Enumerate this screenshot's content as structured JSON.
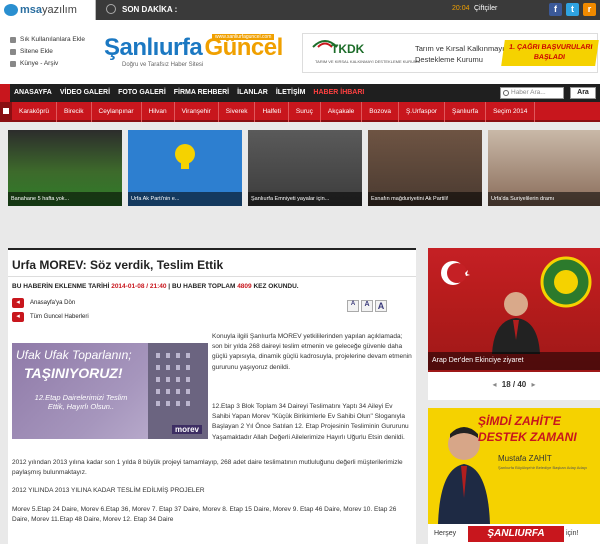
{
  "topbar": {
    "logo_prefix": "msa",
    "logo_suffix": "yazılım",
    "breaking_label": "SON DAKİKA :",
    "time": "20:04",
    "user_link": "Çiftçiler"
  },
  "header_links": [
    "Sık Kullanılanlara Ekle",
    "Sitene Ekle",
    "Künye - Arşiv"
  ],
  "brand": {
    "part1": "Şanlıurfa",
    "part2": "Güncel",
    "tagline": "Doğru ve Tarafsız Haber Sitesi",
    "url": "www.sanliurfaguncel.com"
  },
  "ad_top": {
    "org": "TKDK",
    "org_sub": "TARIM VE KIRSAL KALKINMAYI DESTEKLEME KURUMU",
    "line1": "Tarım ve Kırsal Kalkınmayı",
    "line2": "Destekleme Kurumu",
    "badge": "1. ÇAĞRI BAŞVURULARI BAŞLADI"
  },
  "nav": {
    "items": [
      "ANASAYFA",
      "VİDEO GALERİ",
      "FOTO GALERİ",
      "FİRMA REHBERİ",
      "İLANLAR",
      "İLETİŞİM",
      "HABER İHBARI"
    ],
    "search_placeholder": "Haber Ara...",
    "search_button": "Ara"
  },
  "subnav": [
    "Karaköprü",
    "Birecik",
    "Ceylanpınar",
    "Hilvan",
    "Viranşehir",
    "Siverek",
    "Halfeti",
    "Suruç",
    "Akçakale",
    "Bozova",
    "Ş.Urfaspor",
    "Şanlıurfa",
    "Seçim 2014"
  ],
  "strip": [
    {
      "caption": "Banahane 5 hafta yok..."
    },
    {
      "caption": "Urfa Ak Parti'nin e..."
    },
    {
      "caption": "Şanlıurfa Emniyeti yayalar için..."
    },
    {
      "caption": "Esnafın mağduriyetini Ak Partili!"
    },
    {
      "caption": "Urfa'da Suriyelilerin dramı"
    }
  ],
  "article": {
    "title": "Urfa MOREV: Söz verdik, Teslim Ettik",
    "meta_label1": "BU HABERİN EKLENME TARİHİ",
    "date": "2014-01-08 / 21:40",
    "meta_label2": "BU HABER TOPLAM",
    "views": "4809",
    "meta_label3": "KEZ OKUNDU.",
    "font_buttons": [
      "A",
      "A",
      "A"
    ],
    "back_link": "Anasayfa'ya Dön",
    "all_news_link": "Tüm Guncel Haberleri",
    "image": {
      "line1": "Ufak Ufak Toparlanın;",
      "line2": "TAŞINIYORUZ!",
      "line3": "12.Etap Dairelerimizi Teslim Ettik, Hayırlı Olsun..",
      "brand": "morev"
    },
    "p1": "Konuyla ilgili Şanlıurfa MOREV yetkililerinden yapılan açıklamada; son bir yılda 268 daireyi teslim etmenin ve geleceğe güvenle daha güçlü yapısıyla, dinamik güçlü kadrosuyla, projelerine devam etmenin gururunu yaşıyoruz denildi.",
    "p2": "12.Etap 3 Blok Toplam 34 Daireyi Teslimatını Yaptı 34 Aileyi Ev Sahibi Yapan Morev \"Küçük Birikimlerle Ev Sahibi Olun\" Sloganıyla Başlayan 2 Yıl Önce Satılan 12. Etap Projesinin Tesliminin Gururunu Yaşamaktadır Allah Değerli Ailelerimize Hayırlı Uğurlu Etsin denildi.",
    "p3": "2012 yılından 2013 yılına kadar son 1 yılda 8 büyük projeyi tamamlayıp, 268 adet daire teslimatının mutluluğunu değerli müşterilerimizle paylaşmış bulunmaktayız.",
    "p4": "2012 YILINDA 2013 YILINA KADAR TESLİM EDİLMİŞ PROJELER",
    "p5": "Morev 5.Etap 24 Daire, Morev 6.Etap 36, Morev 7. Etap 37 Daire, Morev 8. Etap 15 Daire, Morev 9. Etap 46 Daire, Morev 10. Etap 26 Daire, Morev 11.Etap 48 Daire, Morev 12. Etap 34 Daire"
  },
  "sidebar": {
    "slider_caption": "Arap Der'den Ekinciye ziyaret",
    "pager": "18 / 40",
    "ad": {
      "line1": "ŞİMDİ ZAHİT'E",
      "line2": "DESTEK ZAMANI",
      "name": "Mustafa ZAHİT",
      "sub": "Şanlıurfa Büyükşehir Belediye Başkan Aday Adayı",
      "footer_left": "Herşey",
      "footer_brand": "ŞANLIURFA",
      "footer_right": "için!"
    }
  },
  "colors": {
    "brand_red": "#c8161d",
    "brand_blue": "#1b78c2",
    "brand_orange": "#f0a000",
    "nav_dark": "#1f1f1f"
  }
}
